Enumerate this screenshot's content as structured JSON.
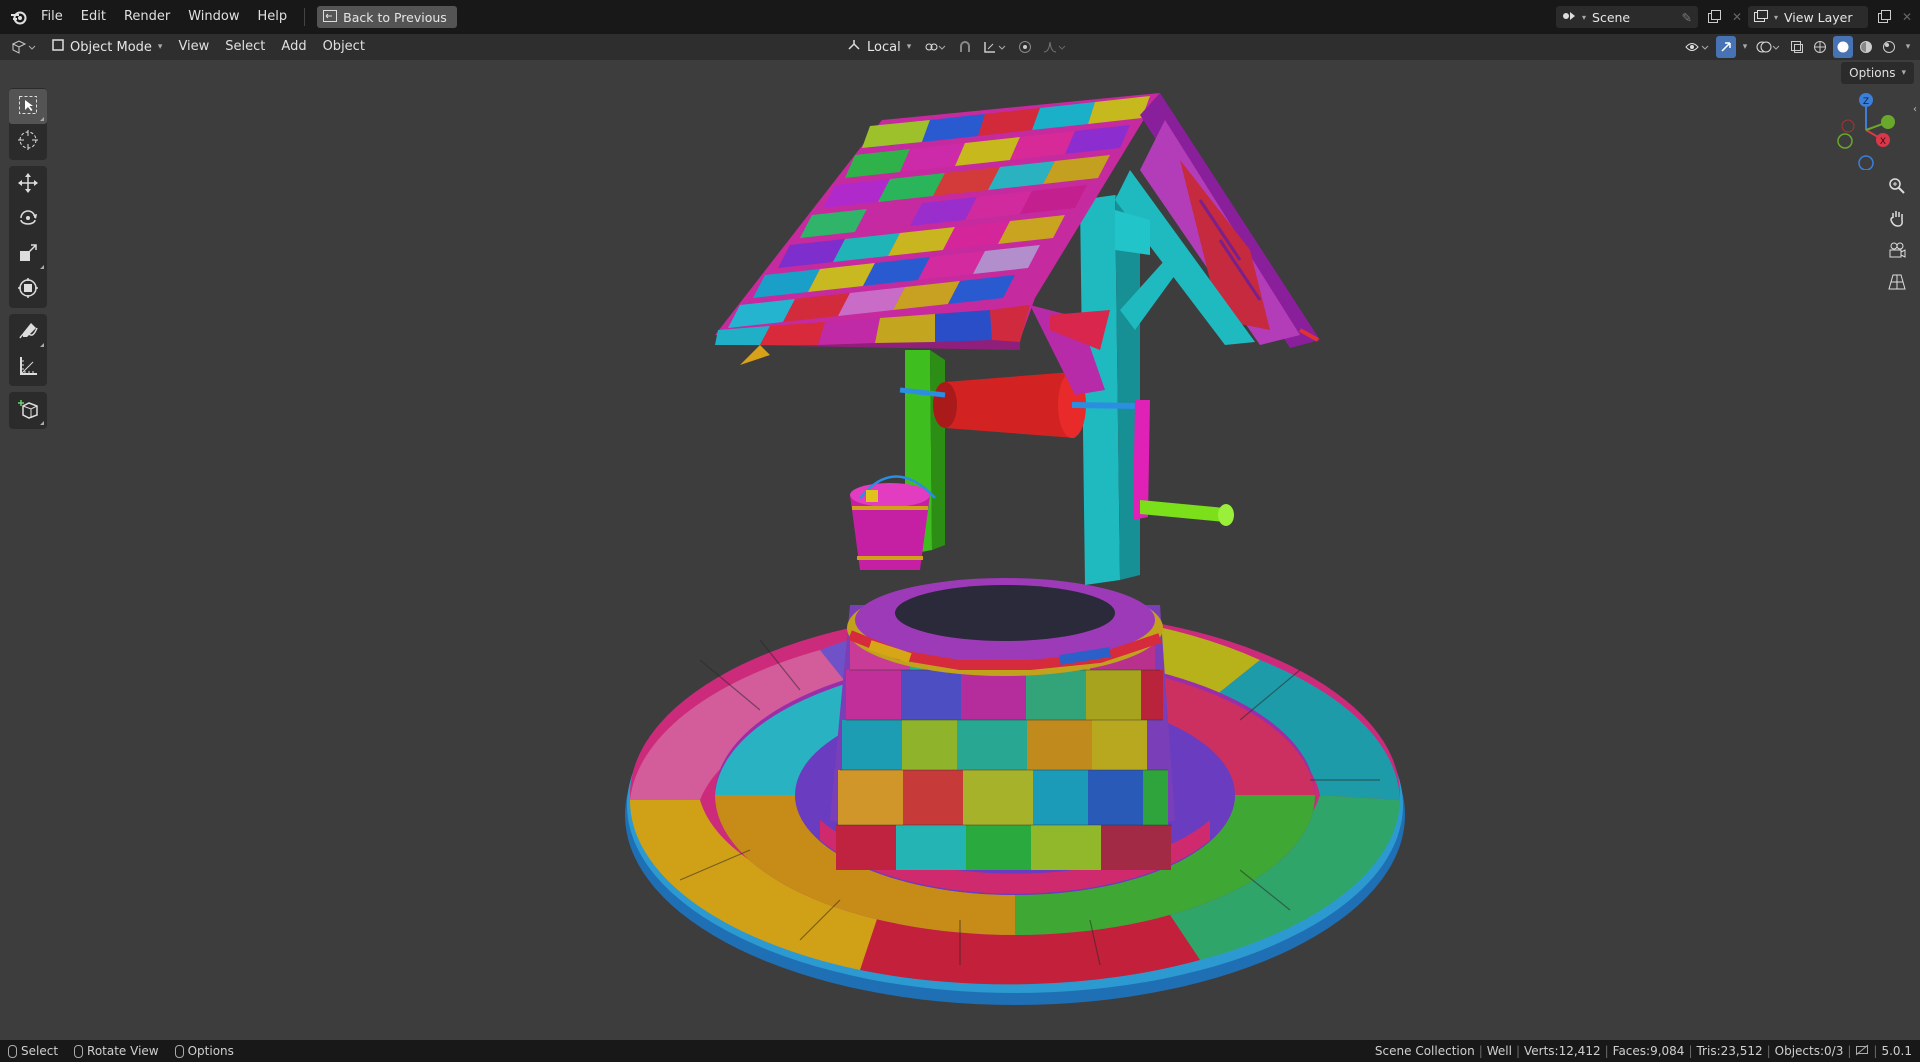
{
  "topbar": {
    "menus": [
      "File",
      "Edit",
      "Render",
      "Window",
      "Help"
    ],
    "back_button": "Back to Previous",
    "scene_name": "Scene",
    "view_layer": "View Layer"
  },
  "header": {
    "mode": "Object Mode",
    "menus": [
      "View",
      "Select",
      "Add",
      "Object"
    ],
    "transform_orientation": "Local"
  },
  "viewport": {
    "options_label": "Options",
    "gizmo_axes": [
      "Z",
      "X"
    ]
  },
  "toolbar": {
    "tools": [
      "select-box-icon",
      "cursor-icon",
      "move-icon",
      "rotate-icon",
      "scale-icon",
      "transform-icon",
      "annotate-icon",
      "measure-icon",
      "add-cube-icon"
    ]
  },
  "statusbar": {
    "hints": [
      "Select",
      "Rotate View",
      "Options"
    ],
    "collection": "Scene Collection",
    "object": "Well",
    "verts": "Verts:12,412",
    "faces": "Faces:9,084",
    "tris": "Tris:23,512",
    "objects": "Objects:0/3",
    "version": "5.0.1"
  },
  "colors": {
    "accent": "#4772b3",
    "menubar": "#181818",
    "header": "#2e2e2e",
    "viewport": "#3d3d3d"
  }
}
